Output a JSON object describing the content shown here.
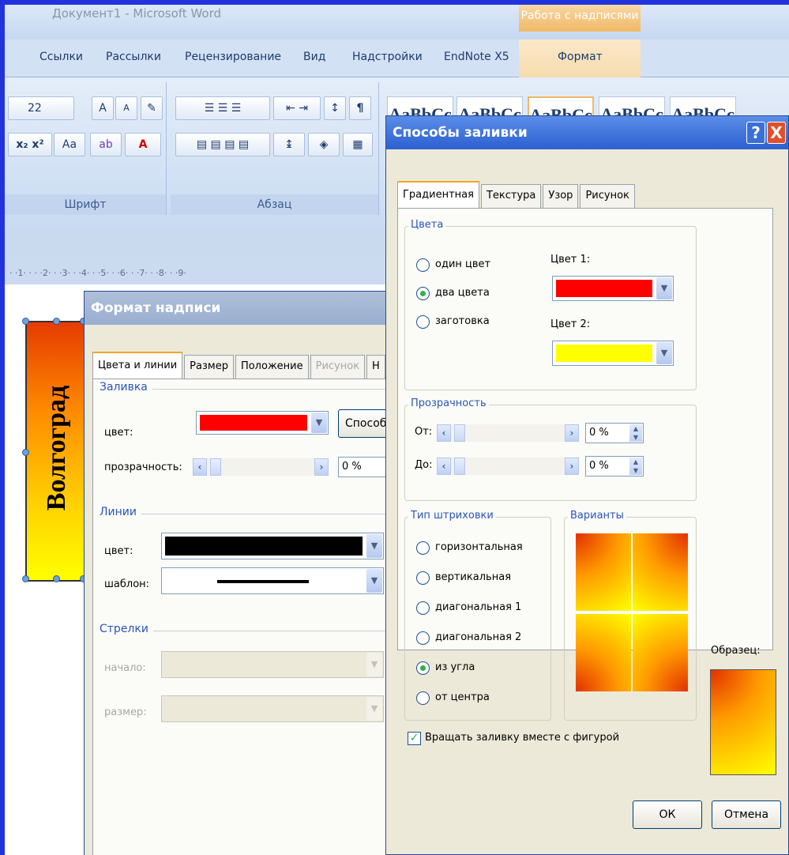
{
  "app": {
    "window_title": "Документ1 - Microsoft Word",
    "context_group": "Работа с надписями"
  },
  "ribbon": {
    "tabs": [
      "Ссылки",
      "Рассылки",
      "Рецензирование",
      "Вид",
      "Надстройки",
      "EndNote X5",
      "Формат"
    ],
    "font_size": "22",
    "groups": {
      "font": "Шрифт",
      "paragraph": "Абзац"
    },
    "style_samples": [
      "AaBbCc",
      "AaBbCc",
      "AaBbCc",
      "AaBbCc",
      "AaBbCc"
    ]
  },
  "ruler_text": "· ·1· · · ·2· · ·3· · ·4· · ·5· · ·6· · ·7· · ·8· · ·9·",
  "shape": {
    "text": "Волгоград",
    "gradient_colors": [
      "#e63b00",
      "#ffff00"
    ]
  },
  "format_dialog": {
    "title": "Формат надписи",
    "tabs": [
      "Цвета и линии",
      "Размер",
      "Положение",
      "Рисунок",
      "Н"
    ],
    "fill_section": "Заливка",
    "fill_color_label": "цвет:",
    "fill_color": "#ff0000",
    "fill_effects_button": "Способы",
    "transparency_label": "прозрачность:",
    "transparency_value": "0 %",
    "lines_section": "Линии",
    "line_color_label": "цвет:",
    "line_color": "#000000",
    "pattern_label": "шаблон:",
    "arrows_section": "Стрелки",
    "begin_label": "начало:",
    "size_label": "размер:"
  },
  "fill_dialog": {
    "title": "Способы заливки",
    "help_glyph": "?",
    "close_glyph": "X",
    "tabs": [
      "Градиентная",
      "Текстура",
      "Узор",
      "Рисунок"
    ],
    "colors_group": "Цвета",
    "radio_one": "один цвет",
    "radio_two": "два цвета",
    "radio_preset": "заготовка",
    "color1_label": "Цвет 1:",
    "color1": "#ff0000",
    "color2_label": "Цвет 2:",
    "color2": "#ffff00",
    "transparency_group": "Прозрачность",
    "from_label": "От:",
    "from_value": "0 %",
    "to_label": "До:",
    "to_value": "0 %",
    "shading_group": "Тип штриховки",
    "shading_options": [
      "горизонтальная",
      "вертикальная",
      "диагональная 1",
      "диагональная 2",
      "из угла",
      "от центра"
    ],
    "shading_selected": "из угла",
    "variants_label": "Варианты",
    "sample_label": "Образец:",
    "rotate_checkbox": "Вращать заливку вместе с фигурой",
    "ok": "ОК",
    "cancel": "Отмена"
  }
}
